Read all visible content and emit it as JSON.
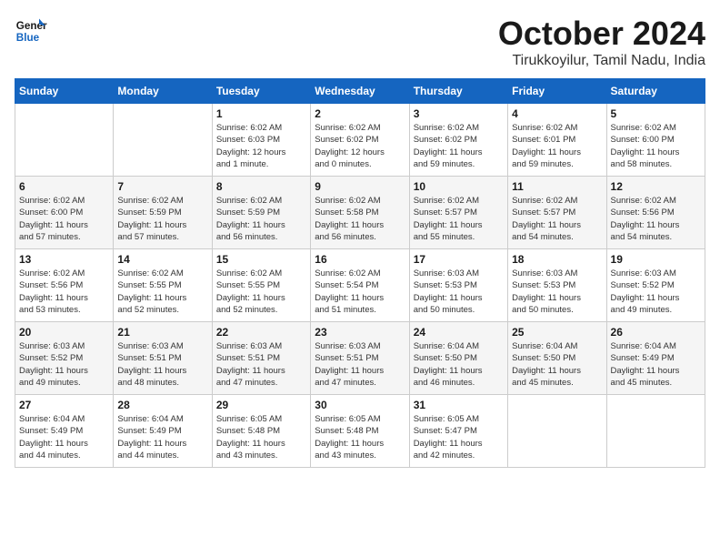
{
  "header": {
    "logo_line1": "General",
    "logo_line2": "Blue",
    "title": "October 2024",
    "subtitle": "Tirukkoyilur, Tamil Nadu, India"
  },
  "days_of_week": [
    "Sunday",
    "Monday",
    "Tuesday",
    "Wednesday",
    "Thursday",
    "Friday",
    "Saturday"
  ],
  "weeks": [
    [
      {
        "day": "",
        "info": ""
      },
      {
        "day": "",
        "info": ""
      },
      {
        "day": "1",
        "info": "Sunrise: 6:02 AM\nSunset: 6:03 PM\nDaylight: 12 hours\nand 1 minute."
      },
      {
        "day": "2",
        "info": "Sunrise: 6:02 AM\nSunset: 6:02 PM\nDaylight: 12 hours\nand 0 minutes."
      },
      {
        "day": "3",
        "info": "Sunrise: 6:02 AM\nSunset: 6:02 PM\nDaylight: 11 hours\nand 59 minutes."
      },
      {
        "day": "4",
        "info": "Sunrise: 6:02 AM\nSunset: 6:01 PM\nDaylight: 11 hours\nand 59 minutes."
      },
      {
        "day": "5",
        "info": "Sunrise: 6:02 AM\nSunset: 6:00 PM\nDaylight: 11 hours\nand 58 minutes."
      }
    ],
    [
      {
        "day": "6",
        "info": "Sunrise: 6:02 AM\nSunset: 6:00 PM\nDaylight: 11 hours\nand 57 minutes."
      },
      {
        "day": "7",
        "info": "Sunrise: 6:02 AM\nSunset: 5:59 PM\nDaylight: 11 hours\nand 57 minutes."
      },
      {
        "day": "8",
        "info": "Sunrise: 6:02 AM\nSunset: 5:59 PM\nDaylight: 11 hours\nand 56 minutes."
      },
      {
        "day": "9",
        "info": "Sunrise: 6:02 AM\nSunset: 5:58 PM\nDaylight: 11 hours\nand 56 minutes."
      },
      {
        "day": "10",
        "info": "Sunrise: 6:02 AM\nSunset: 5:57 PM\nDaylight: 11 hours\nand 55 minutes."
      },
      {
        "day": "11",
        "info": "Sunrise: 6:02 AM\nSunset: 5:57 PM\nDaylight: 11 hours\nand 54 minutes."
      },
      {
        "day": "12",
        "info": "Sunrise: 6:02 AM\nSunset: 5:56 PM\nDaylight: 11 hours\nand 54 minutes."
      }
    ],
    [
      {
        "day": "13",
        "info": "Sunrise: 6:02 AM\nSunset: 5:56 PM\nDaylight: 11 hours\nand 53 minutes."
      },
      {
        "day": "14",
        "info": "Sunrise: 6:02 AM\nSunset: 5:55 PM\nDaylight: 11 hours\nand 52 minutes."
      },
      {
        "day": "15",
        "info": "Sunrise: 6:02 AM\nSunset: 5:55 PM\nDaylight: 11 hours\nand 52 minutes."
      },
      {
        "day": "16",
        "info": "Sunrise: 6:02 AM\nSunset: 5:54 PM\nDaylight: 11 hours\nand 51 minutes."
      },
      {
        "day": "17",
        "info": "Sunrise: 6:03 AM\nSunset: 5:53 PM\nDaylight: 11 hours\nand 50 minutes."
      },
      {
        "day": "18",
        "info": "Sunrise: 6:03 AM\nSunset: 5:53 PM\nDaylight: 11 hours\nand 50 minutes."
      },
      {
        "day": "19",
        "info": "Sunrise: 6:03 AM\nSunset: 5:52 PM\nDaylight: 11 hours\nand 49 minutes."
      }
    ],
    [
      {
        "day": "20",
        "info": "Sunrise: 6:03 AM\nSunset: 5:52 PM\nDaylight: 11 hours\nand 49 minutes."
      },
      {
        "day": "21",
        "info": "Sunrise: 6:03 AM\nSunset: 5:51 PM\nDaylight: 11 hours\nand 48 minutes."
      },
      {
        "day": "22",
        "info": "Sunrise: 6:03 AM\nSunset: 5:51 PM\nDaylight: 11 hours\nand 47 minutes."
      },
      {
        "day": "23",
        "info": "Sunrise: 6:03 AM\nSunset: 5:51 PM\nDaylight: 11 hours\nand 47 minutes."
      },
      {
        "day": "24",
        "info": "Sunrise: 6:04 AM\nSunset: 5:50 PM\nDaylight: 11 hours\nand 46 minutes."
      },
      {
        "day": "25",
        "info": "Sunrise: 6:04 AM\nSunset: 5:50 PM\nDaylight: 11 hours\nand 45 minutes."
      },
      {
        "day": "26",
        "info": "Sunrise: 6:04 AM\nSunset: 5:49 PM\nDaylight: 11 hours\nand 45 minutes."
      }
    ],
    [
      {
        "day": "27",
        "info": "Sunrise: 6:04 AM\nSunset: 5:49 PM\nDaylight: 11 hours\nand 44 minutes."
      },
      {
        "day": "28",
        "info": "Sunrise: 6:04 AM\nSunset: 5:49 PM\nDaylight: 11 hours\nand 44 minutes."
      },
      {
        "day": "29",
        "info": "Sunrise: 6:05 AM\nSunset: 5:48 PM\nDaylight: 11 hours\nand 43 minutes."
      },
      {
        "day": "30",
        "info": "Sunrise: 6:05 AM\nSunset: 5:48 PM\nDaylight: 11 hours\nand 43 minutes."
      },
      {
        "day": "31",
        "info": "Sunrise: 6:05 AM\nSunset: 5:47 PM\nDaylight: 11 hours\nand 42 minutes."
      },
      {
        "day": "",
        "info": ""
      },
      {
        "day": "",
        "info": ""
      }
    ]
  ]
}
